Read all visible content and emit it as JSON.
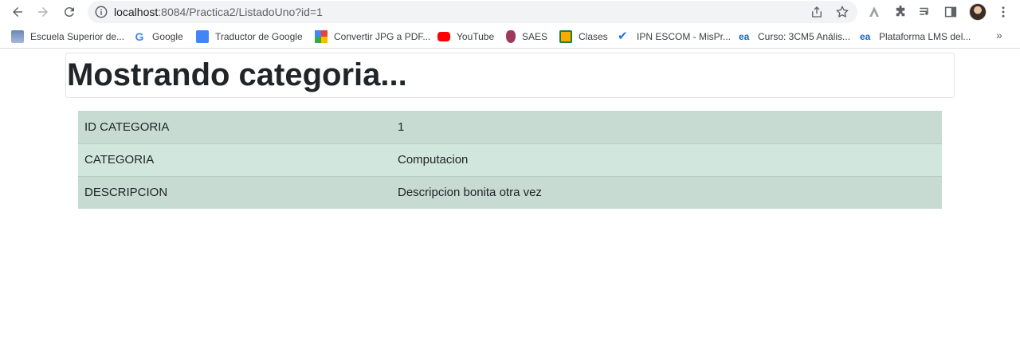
{
  "browser": {
    "url_host": "localhost",
    "url_rest": ":8084/Practica2/ListadoUno?id=1",
    "bookmarks": [
      {
        "label": "Escuela Superior de...",
        "icon": "escom-icon"
      },
      {
        "label": "Google",
        "icon": "google-icon"
      },
      {
        "label": "Traductor de Google",
        "icon": "translate-icon"
      },
      {
        "label": "Convertir JPG a PDF...",
        "icon": "converter-icon"
      },
      {
        "label": "YouTube",
        "icon": "youtube-icon"
      },
      {
        "label": "SAES",
        "icon": "saes-icon"
      },
      {
        "label": "Clases",
        "icon": "classroom-icon"
      },
      {
        "label": "IPN ESCOM - MisPr...",
        "icon": "checkmark-icon"
      },
      {
        "label": "Curso: 3CM5 Anális...",
        "icon": "ea-icon"
      },
      {
        "label": "Plataforma LMS del...",
        "icon": "ea-icon"
      }
    ],
    "more_label": "»"
  },
  "page": {
    "heading": "Mostrando categoria...",
    "rows": [
      {
        "key": "ID CATEGORIA",
        "value": "1"
      },
      {
        "key": "CATEGORIA",
        "value": "Computacion"
      },
      {
        "key": "DESCRIPCION",
        "value": "Descripcion bonita otra vez"
      }
    ]
  },
  "colors": {
    "row_dark": "#c7dbd2",
    "row_light": "#d1e6dd",
    "omnibox": "#f1f3f4"
  }
}
